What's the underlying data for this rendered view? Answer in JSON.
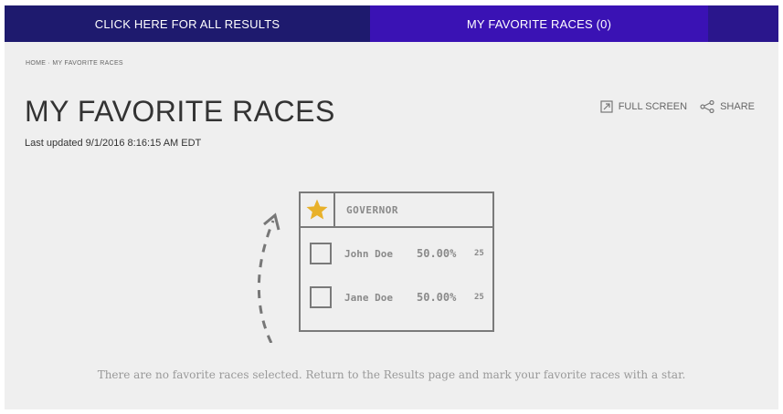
{
  "nav": {
    "all_results": "CLICK HERE FOR ALL RESULTS",
    "favorites": "MY FAVORITE RACES (0)"
  },
  "breadcrumb": "HOME · MY FAVORITE RACES",
  "page": {
    "title": "MY FAVORITE RACES",
    "updated": "Last updated 9/1/2016 8:16:15 AM EDT"
  },
  "actions": {
    "fullscreen": "FULL SCREEN",
    "share": "SHARE"
  },
  "illustration": {
    "race": "GOVERNOR",
    "candidates": [
      {
        "name": "John Doe",
        "pct": "50.00%",
        "votes": "25"
      },
      {
        "name": "Jane Doe",
        "pct": "50.00%",
        "votes": "25"
      }
    ],
    "star_color": "#e8b12a"
  },
  "empty_message": "There are no favorite races selected. Return to the Results page and mark your favorite races with a star.",
  "colors": {
    "nav_all": "#1e1a6e",
    "nav_favorites": "#3a12b4",
    "background": "#efefef"
  }
}
